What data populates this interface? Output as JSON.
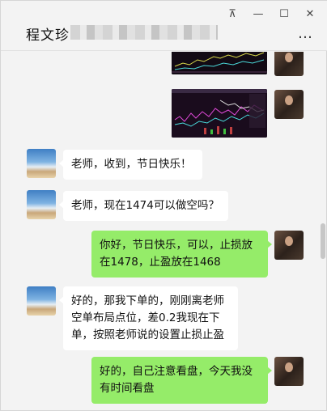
{
  "window": {
    "title": "程文珍",
    "more_glyph": "…",
    "controls": {
      "pin": "⊼",
      "minimize": "—",
      "maximize": "☐",
      "close": "✕"
    }
  },
  "messages": [
    {
      "side": "out",
      "type": "image",
      "kind": "chart-screenshot"
    },
    {
      "side": "out",
      "type": "image",
      "kind": "chart-screenshot"
    },
    {
      "side": "in",
      "type": "text",
      "text": "老师，收到，节日快乐！"
    },
    {
      "side": "in",
      "type": "text",
      "text": "老师，现在1474可以做空吗？"
    },
    {
      "side": "out",
      "type": "text",
      "lines": [
        "你好，节日快乐，可以，止损放",
        "在1478，止盈放在1468"
      ]
    },
    {
      "side": "in",
      "type": "text",
      "lines": [
        "好的，那我下单的，刚刚离老师",
        "空单布局点位，差0.2我现在下",
        "单，按照老师说的设置止损止盈"
      ]
    },
    {
      "side": "out",
      "type": "text",
      "lines": [
        "好的，自己注意看盘，今天我没",
        "有时间看盘"
      ]
    }
  ],
  "colors": {
    "incoming_bubble": "#ffffff",
    "outgoing_bubble": "#95ec69",
    "background": "#f3f3f3"
  }
}
